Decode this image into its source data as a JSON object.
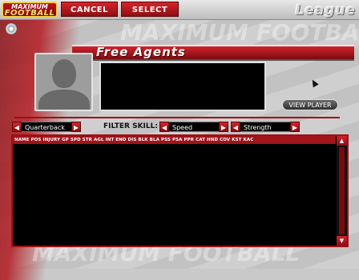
{
  "app": {
    "logo_top": "MAXIMUM",
    "logo_main": "FOOTBALL"
  },
  "toolbar": {
    "cancel_label": "CANCEL",
    "select_label": "SELECT",
    "section_title": "League"
  },
  "background": {
    "watermark": "MAXIMUM FOOTBALL"
  },
  "panel": {
    "title": "Free Agents",
    "view_player_label": "VIEW PLAYER"
  },
  "filters": {
    "position": {
      "value": "Quarterback",
      "left_arrow": "◀",
      "right_arrow": "▶"
    },
    "filter_skill_label": "FILTER SKILL:",
    "skill1": {
      "value": "Speed",
      "left_arrow": "◀",
      "right_arrow": "▶"
    },
    "skill2": {
      "value": "Strength",
      "left_arrow": "◀",
      "right_arrow": "▶"
    }
  },
  "table": {
    "columns": [
      "NAME",
      "POS",
      "INJURY",
      "GP",
      "SPD",
      "STR",
      "AGL",
      "INT",
      "END",
      "DIS",
      "BLK",
      "BLA",
      "PSS",
      "PSA",
      "PPR",
      "CAT",
      "HND",
      "COV",
      "KST",
      "KAC"
    ],
    "rows": []
  },
  "scrollbar": {
    "up": "▲",
    "down": "▼"
  },
  "colors": {
    "accent": "#c1141b",
    "panel_black": "#000000",
    "background": "#c9c9c9"
  }
}
